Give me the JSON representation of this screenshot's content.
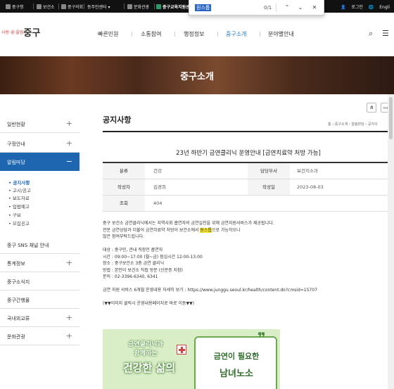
{
  "topbar": {
    "links": [
      "중구청",
      "보건소",
      "중구의회",
      "동주민센터",
      "문화관광",
      "중구교육지원센"
    ],
    "login": "로그인",
    "lang": "Engli"
  },
  "findbar": {
    "query": "원스톱",
    "count": "0/1"
  },
  "header": {
    "logo_small": "사랑·꿈·울림",
    "logo": "중구",
    "nav": [
      "빠른민원",
      "소통참여",
      "행정정보",
      "중구소개",
      "분야별안내"
    ],
    "active_nav": "중구소개"
  },
  "banner": {
    "title": "중구소개"
  },
  "sidebar": {
    "items": [
      {
        "label": "일반현황",
        "pm": "+"
      },
      {
        "label": "구정안내",
        "pm": "+"
      },
      {
        "label": "알림마당",
        "pm": "−"
      },
      {
        "label": "중구 SNS 채널 안내",
        "pm": ""
      },
      {
        "label": "통계정보",
        "pm": "+"
      },
      {
        "label": "중구소식지",
        "pm": ""
      },
      {
        "label": "중구간행물",
        "pm": ""
      },
      {
        "label": "국내외교류",
        "pm": "+"
      },
      {
        "label": "문화관광",
        "pm": "+"
      }
    ],
    "subitems": [
      "공지사항",
      "고시/공고",
      "보도자료",
      "입법예고",
      "구보",
      "모집공고"
    ]
  },
  "content": {
    "title": "공지사항",
    "breadcrumb": "홈 › 중구소개 › 알림마당 › 공지사",
    "post_title": "23년 하반기 금연클리닉 운영안내 [금연치료약 처방 가능]",
    "meta": {
      "category_label": "분류",
      "category": "건강",
      "dept_label": "담당부서",
      "dept": "보건지소과",
      "author_label": "작성자",
      "author": "김경희",
      "date_label": "작성일",
      "date": "2023-08-03",
      "views_label": "조회",
      "views": "404"
    },
    "body": {
      "p1": "중구 보건소 금연클리닉에서는 지역사회 흡연자의 금연실천을 위해 금연지원서비스가 제공됩니다.",
      "p2_pre": "전문 금연상담과 더불어 금연치료약 처방이 보건소에서 ",
      "p2_mark": "원스톱",
      "p2_post": "으로 가능하오니",
      "p3": "많은 참여부탁드립니다.",
      "l1": "대상 : 중구민, 관내 직장인 흡연자",
      "l2": "시간 : 09:00~17:00 (월~금) 점심시간 12:00-13:00",
      "l3": "장소 : 중구보건소 3층 금연 클리닉",
      "l4": "방법 : 본인이 보건소 직접 방문 (신분증 지참)",
      "l5": "문의 : 02-3396-6340, 6341",
      "link": "금연 지원 서비스 6개월 운영내용 자세히 보기 : https://www.junggu.seoul.kr/health/content.do?cmsid=15707",
      "note": "(▼▼이미지 클릭시 운영내용페이지로 바로 이동▼▼)"
    },
    "poster": {
      "line1": "금연클리닉과",
      "line1b": "함께하는",
      "line2": "건강한 삶의",
      "bubble1": "금연이 필요한",
      "bubble2": "남녀노소"
    }
  }
}
